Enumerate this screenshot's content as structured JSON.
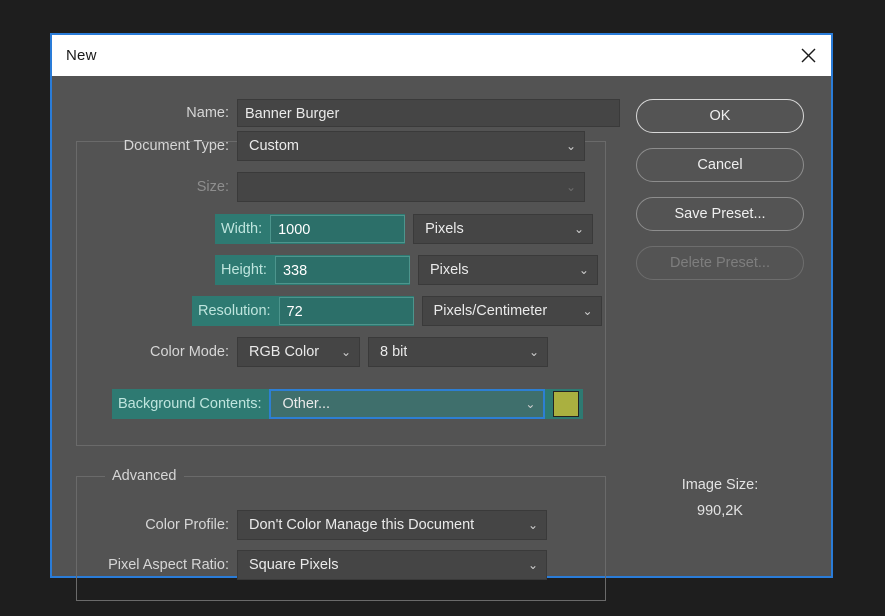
{
  "window": {
    "title": "New",
    "close_icon": "close-icon",
    "accent_border": "#2a7cd8"
  },
  "form": {
    "name": {
      "label": "Name:",
      "value": "Banner Burger"
    },
    "document_type": {
      "label": "Document Type:",
      "value": "Custom"
    },
    "size": {
      "label": "Size:",
      "value": ""
    },
    "width": {
      "label": "Width:",
      "value": "1000",
      "unit": "Pixels"
    },
    "height": {
      "label": "Height:",
      "value": "338",
      "unit": "Pixels"
    },
    "resolution": {
      "label": "Resolution:",
      "value": "72",
      "unit": "Pixels/Centimeter"
    },
    "color_mode": {
      "label": "Color Mode:",
      "value": "RGB Color",
      "depth": "8 bit"
    },
    "background_contents": {
      "label": "Background Contents:",
      "value": "Other...",
      "swatch_color": "#aab040"
    }
  },
  "advanced": {
    "legend": "Advanced",
    "color_profile": {
      "label": "Color Profile:",
      "value": "Don't Color Manage this Document"
    },
    "pixel_aspect_ratio": {
      "label": "Pixel Aspect Ratio:",
      "value": "Square Pixels"
    }
  },
  "buttons": {
    "ok": "OK",
    "cancel": "Cancel",
    "save_preset": "Save Preset...",
    "delete_preset": "Delete Preset..."
  },
  "image_size": {
    "label": "Image Size:",
    "value": "990,2K"
  },
  "colors": {
    "highlight_teal": "#2e7a72",
    "focus_blue": "#2d7fd3",
    "dialog_bg": "#535353"
  },
  "icons": {
    "chevron": "⌄"
  }
}
